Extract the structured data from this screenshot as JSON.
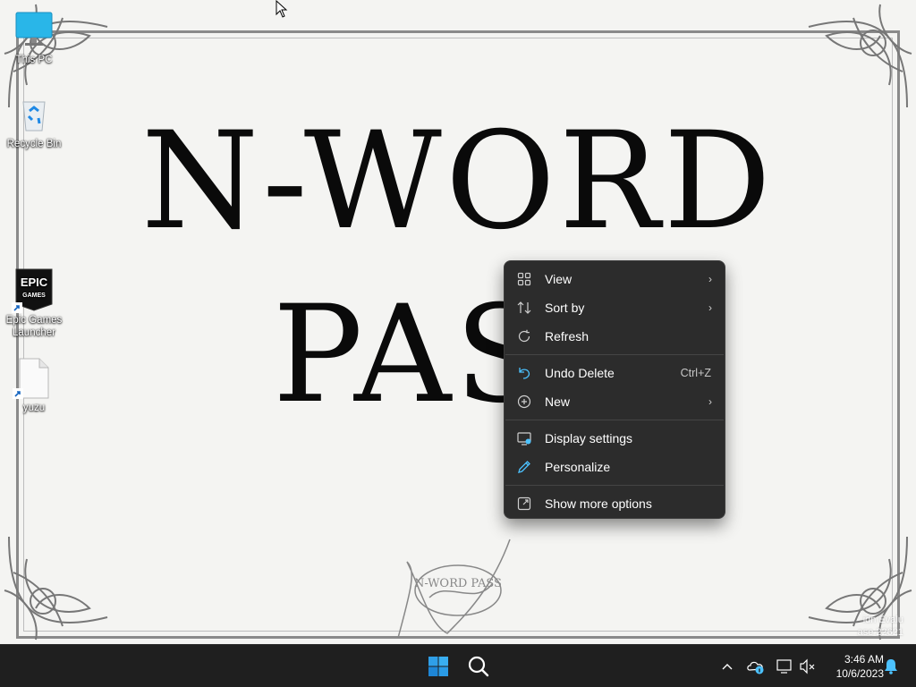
{
  "wallpaper": {
    "title_line1": "N-WORD",
    "title_line2": "PASS",
    "signature_text": "N-WORD PASS",
    "watermark_line1": "idn Evalu",
    "watermark_line2": "ase 22621"
  },
  "desktop_icons": [
    {
      "label": "This PC",
      "icon": "this-pc-icon"
    },
    {
      "label": "Recycle Bin",
      "icon": "recycle-bin-icon"
    },
    {
      "label": "Epic Games Launcher",
      "icon": "epic-games-icon",
      "logo_text_1": "EPIC",
      "logo_text_2": "GAMES"
    },
    {
      "label": "yuzu",
      "icon": "file-icon"
    }
  ],
  "context_menu": {
    "items": [
      {
        "label": "View",
        "icon": "grid-icon",
        "submenu": true
      },
      {
        "label": "Sort by",
        "icon": "sort-icon",
        "submenu": true
      },
      {
        "label": "Refresh",
        "icon": "refresh-icon"
      },
      {
        "label": "Undo Delete",
        "icon": "undo-icon",
        "shortcut": "Ctrl+Z"
      },
      {
        "label": "New",
        "icon": "plus-circle-icon",
        "submenu": true
      },
      {
        "label": "Display settings",
        "icon": "display-icon"
      },
      {
        "label": "Personalize",
        "icon": "pen-icon"
      },
      {
        "label": "Show more options",
        "icon": "expand-icon"
      }
    ],
    "arrow_glyph": "›"
  },
  "taskbar": {
    "start_icon": "windows-logo-icon",
    "search_icon": "search-icon",
    "tray_icons": [
      "chevron-up-icon",
      "onedrive-icon",
      "network-icon",
      "volume-muted-icon"
    ],
    "time": "3:46 AM",
    "date": "10/6/2023",
    "notification_icon": "bell-icon"
  },
  "colors": {
    "menu_bg": "#2c2c2c",
    "taskbar_bg": "#1f1f1f",
    "accent_blue": "#4cc2ff"
  }
}
